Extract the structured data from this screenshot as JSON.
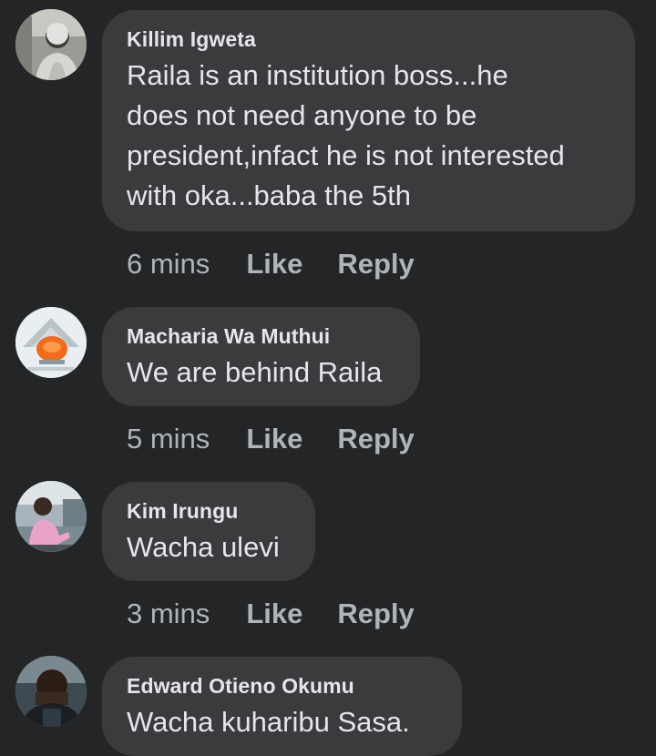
{
  "comments": [
    {
      "author": "Killim Igweta",
      "text": "Raila is an institution boss...he\ndoes not need anyone to be\npresident,infact he is not interested\nwith oka...baba the 5th",
      "time": "6 mins",
      "like_label": "Like",
      "reply_label": "Reply",
      "avatar_icon": "profile-photo-icon"
    },
    {
      "author": "Macharia Wa Muthui",
      "text": "We are behind Raila",
      "time": "5 mins",
      "like_label": "Like",
      "reply_label": "Reply",
      "avatar_icon": "orange-logo-photo-icon"
    },
    {
      "author": "Kim Irungu",
      "text": "Wacha ulevi",
      "time": "3 mins",
      "like_label": "Like",
      "reply_label": "Reply",
      "avatar_icon": "profile-photo-icon"
    },
    {
      "author": "Edward Otieno Okumu",
      "text": "Wacha kuharibu Sasa.",
      "avatar_icon": "profile-photo-icon"
    }
  ],
  "colors": {
    "background": "#242526",
    "bubble": "#3a3b3c",
    "primary_text": "#e4e6eb",
    "secondary_text": "#b0b3b8"
  }
}
